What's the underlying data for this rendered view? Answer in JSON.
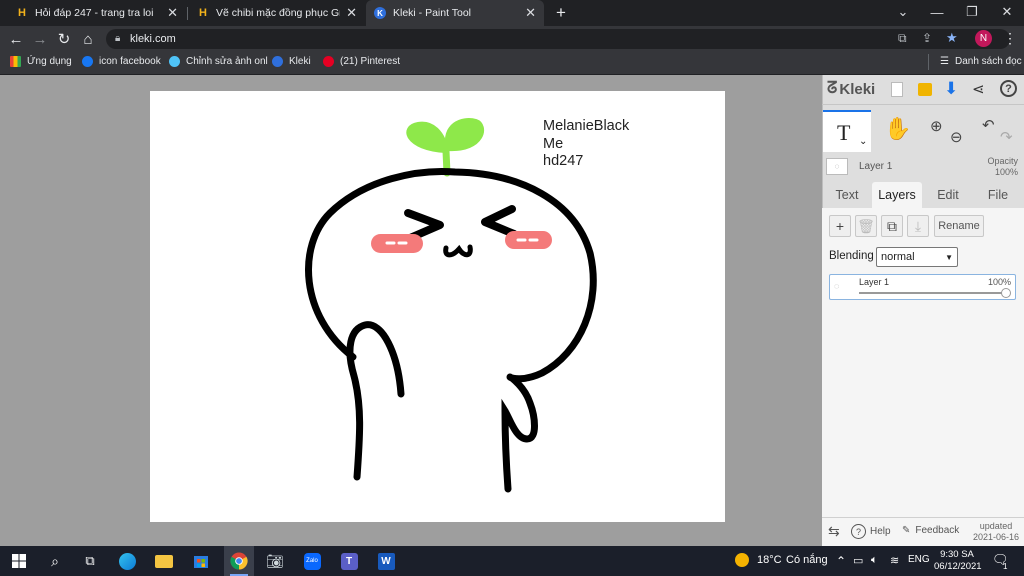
{
  "browser": {
    "tabs": [
      {
        "title": "Hỏi đáp 247 - trang tra loi",
        "favicon": "H"
      },
      {
        "title": "Vẽ chibi mặc đồng phục Gryffindor",
        "favicon": "H"
      },
      {
        "title": "Kleki - Paint Tool",
        "favicon": "K"
      }
    ],
    "new_tab": "+",
    "close_glyph": "✕",
    "url": "kleki.com",
    "profile_initial": "N",
    "bookmarks": [
      "Ứng dụng",
      "icon facebook",
      "Chỉnh sửa ảnh onl",
      "Kleki",
      "(21) Pinterest"
    ],
    "reading_list": "Danh sách đọc"
  },
  "canvas": {
    "texts": [
      "MelanieBlack",
      "Me",
      "hd247"
    ]
  },
  "kleki": {
    "logo": "Kleki",
    "layer_name": "Layer 1",
    "opacity_label": "Opacity",
    "opacity_value": "100%",
    "tabs": [
      "Text",
      "Layers",
      "Edit",
      "File"
    ],
    "active_tab": "Layers",
    "rename_label": "Rename",
    "blending_label": "Blending",
    "blending_value": "normal",
    "layer_item": {
      "name": "Layer 1",
      "opacity": "100%",
      "opacity_fraction": 1.0
    },
    "help_label": "Help",
    "feedback_label": "Feedback",
    "updated_label": "updated",
    "updated_date": "2021-06-16"
  },
  "taskbar": {
    "temperature": "18°C",
    "weather": "Có nắng",
    "lang": "ENG",
    "time": "9:30 SA",
    "date": "06/12/2021",
    "notif_count": "1"
  },
  "colors": {
    "chrome_dark": "#202124",
    "chrome_toolbar": "#35363a",
    "kleki_accent": "#1a73e8",
    "sprout_green": "#8ee84a",
    "blush": "#f47a7a"
  }
}
